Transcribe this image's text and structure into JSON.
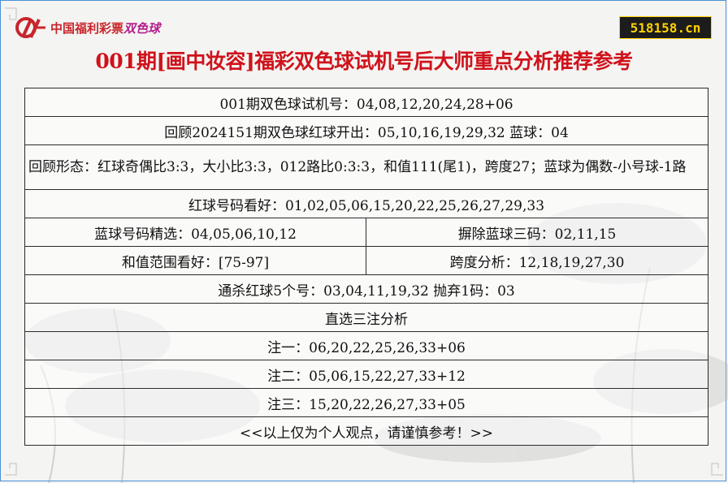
{
  "header": {
    "logo_text": "中国福利彩票",
    "logo_highlight": "双色球",
    "site_badge": "518158.cn",
    "title": "001期[画中妆容]福彩双色球试机号后大师重点分析推荐参考"
  },
  "rows": {
    "test_number": "001期双色球试机号：04,08,12,20,24,28+06",
    "review": "回顾2024151期双色球红球开出：05,10,16,19,29,32 蓝球：04",
    "pattern": "回顾形态：红球奇偶比3:3，大小比3:3，012路比0:3:3，和值111(尾1)，跨度27；蓝球为偶数-小号球-1路",
    "red_pick": "红球号码看好：01,02,05,06,15,20,22,25,26,27,29,33",
    "blue_pick": "蓝球号码精选：04,05,06,10,12",
    "blue_kill": "摒除蓝球三码：02,11,15",
    "sum_range": "和值范围看好：[75-97]",
    "span": "跨度分析：12,18,19,27,30",
    "kill_red": "通杀红球5个号：03,04,11,19,32 抛弃1码：03",
    "section": "直选三注分析",
    "bet1": "注一：06,20,22,25,26,33+06",
    "bet2": "注二：05,06,15,22,27,33+12",
    "bet3": "注三：15,20,22,26,27,33+05",
    "footer": "<<以上仅为个人观点，请谨慎参考！>>"
  },
  "colors": {
    "title": "#d0121b",
    "badge_bg": "#1c1c1c",
    "badge_text": "#ffd200",
    "logo_red": "#c8252c",
    "logo_magenta": "#b51f8e",
    "border": "#4a90d9"
  },
  "icons": {
    "logo": "lottery-logo-icon"
  }
}
